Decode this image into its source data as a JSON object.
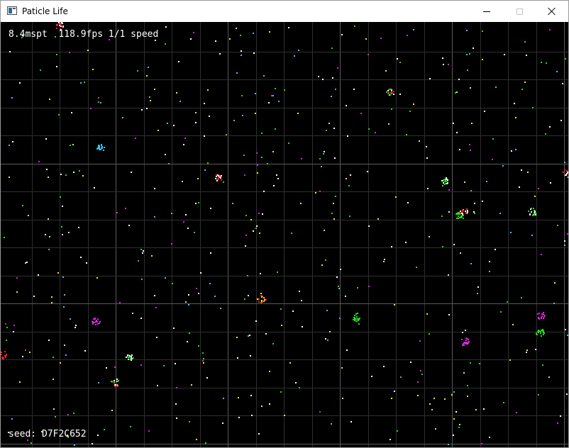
{
  "window": {
    "title": "Paticle Life",
    "icon": "app-window-icon",
    "controls": [
      "minimize-icon",
      "maximize-icon",
      "close-icon"
    ]
  },
  "hud": {
    "stats": "8.4mspt  118.9fps 1/1 speed",
    "seed": "seed: D7F2C652"
  },
  "colors": {
    "background": "#000000",
    "grid": "#2e2e2e",
    "grid_major": "#5a5a5a",
    "red": "#ff2020",
    "green": "#22dd22",
    "magenta": "#dd22dd",
    "cyan": "#33ccee",
    "yellow": "#eeee22",
    "white": "#ffffff"
  }
}
